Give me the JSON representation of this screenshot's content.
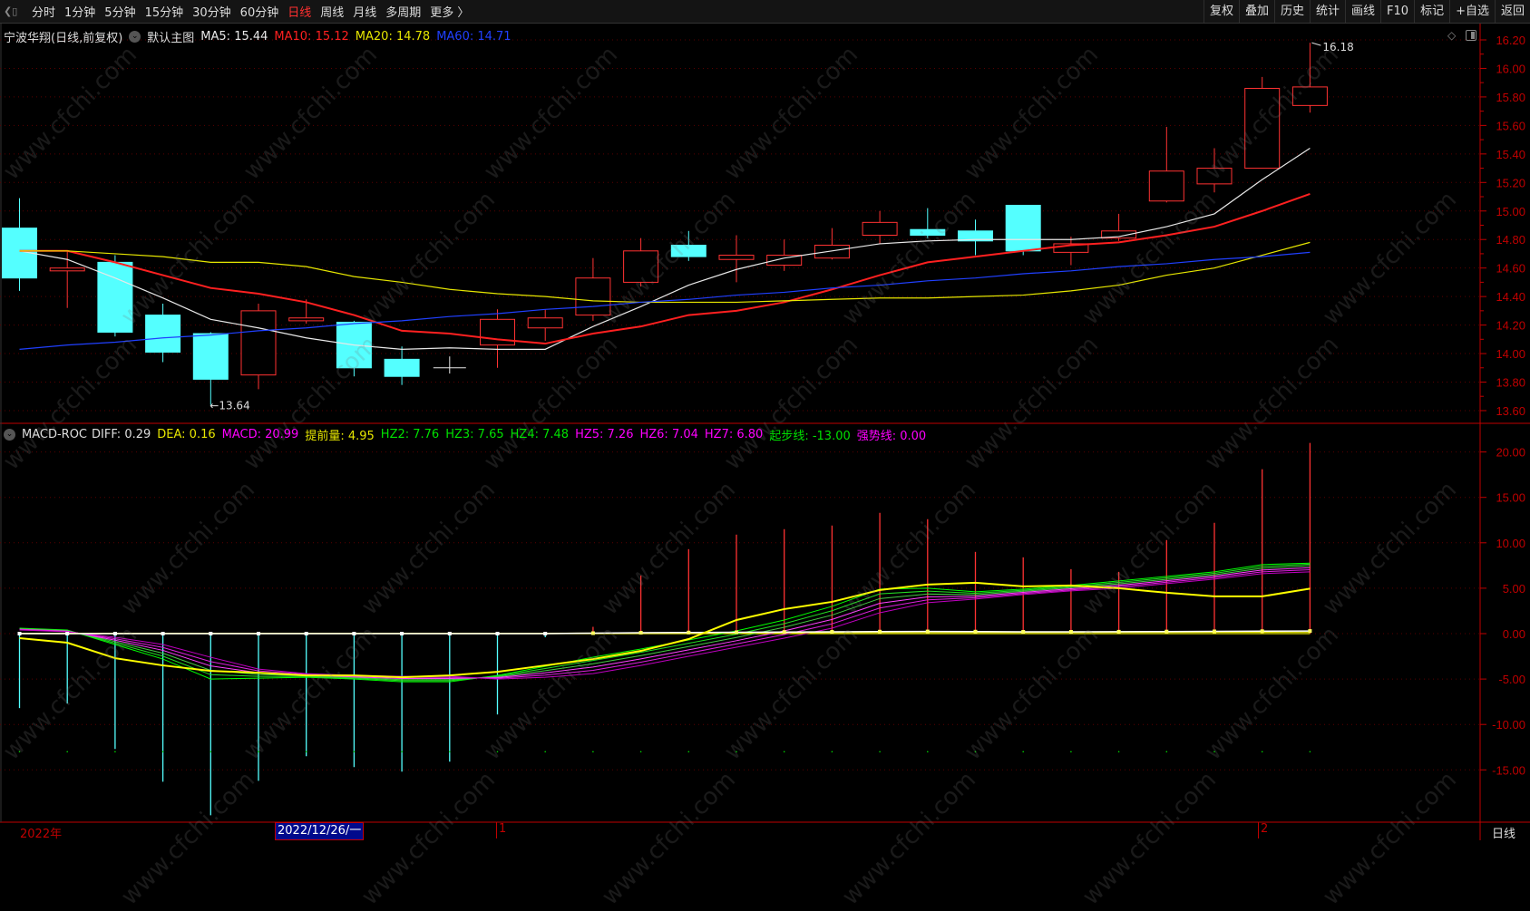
{
  "toolbar": {
    "periods": [
      "分时",
      "1分钟",
      "5分钟",
      "15分钟",
      "30分钟",
      "60分钟",
      "日线",
      "周线",
      "月线",
      "多周期",
      "更多 〉"
    ],
    "active_period": "日线",
    "right_buttons": [
      "复权",
      "叠加",
      "历史",
      "统计",
      "画线",
      "F10",
      "标记",
      "+自选",
      "返回"
    ]
  },
  "price_header": {
    "title": "宁波华翔(日线,前复权)",
    "template": "默认主图",
    "ma5": "MA5: 15.44",
    "ma10": "MA10: 15.12",
    "ma20": "MA20: 14.78",
    "ma60": "MA60: 14.71"
  },
  "indicator_header": {
    "name": "MACD-ROC",
    "diff": "DIFF: 0.29",
    "dea": "DEA: 0.16",
    "macd": "MACD: 20.99",
    "tiqian": "提前量: 4.95",
    "hz2": "HZ2: 7.76",
    "hz3": "HZ3: 7.65",
    "hz4": "HZ4: 7.48",
    "hz5": "HZ5: 7.26",
    "hz6": "HZ6: 7.04",
    "hz7": "HZ7: 6.80",
    "qibu": "起步线: -13.00",
    "qiangshi": "强势线: 0.00"
  },
  "annotations": {
    "high": "16.18",
    "low": "←13.64"
  },
  "x_axis": {
    "year": "2022年",
    "cursor_date": "2022/12/26/一",
    "month1": "1",
    "month2": "2",
    "period": "日线"
  },
  "watermark": "www.cfchi.com",
  "colors": {
    "up": "#ff3232",
    "down": "#54ffff",
    "ma5": "#e8e8e8",
    "ma10": "#ff2020",
    "ma20": "#e6e600",
    "ma60": "#2040ff",
    "axis": "#c00000",
    "hz_green": "#00e000",
    "hz_magenta": "#ff00ff",
    "tiqian": "#ffff00"
  },
  "chart_data": [
    {
      "type": "candlestick",
      "y_ticks": [
        "16.20",
        "16.00",
        "15.80",
        "15.60",
        "15.40",
        "15.20",
        "15.00",
        "14.80",
        "14.60",
        "14.40",
        "14.20",
        "14.00",
        "13.80",
        "13.60"
      ],
      "ylim": [
        13.6,
        16.2
      ],
      "candles": [
        {
          "o": 14.88,
          "h": 15.09,
          "l": 14.44,
          "c": 14.53
        },
        {
          "o": 14.58,
          "h": 14.72,
          "l": 14.32,
          "c": 14.6
        },
        {
          "o": 14.64,
          "h": 14.69,
          "l": 14.12,
          "c": 14.15
        },
        {
          "o": 14.27,
          "h": 14.35,
          "l": 13.94,
          "c": 14.01
        },
        {
          "o": 14.14,
          "h": 14.15,
          "l": 13.64,
          "c": 13.82
        },
        {
          "o": 13.85,
          "h": 14.35,
          "l": 13.75,
          "c": 14.3
        },
        {
          "o": 14.23,
          "h": 14.38,
          "l": 14.21,
          "c": 14.25
        },
        {
          "o": 14.22,
          "h": 14.23,
          "l": 13.84,
          "c": 13.9
        },
        {
          "o": 13.96,
          "h": 14.05,
          "l": 13.78,
          "c": 13.84
        },
        {
          "o": 13.9,
          "h": 13.98,
          "l": 13.86,
          "c": 13.9
        },
        {
          "o": 14.06,
          "h": 14.31,
          "l": 13.9,
          "c": 14.24
        },
        {
          "o": 14.18,
          "h": 14.31,
          "l": 14.09,
          "c": 14.25
        },
        {
          "o": 14.27,
          "h": 14.67,
          "l": 14.23,
          "c": 14.53
        },
        {
          "o": 14.5,
          "h": 14.81,
          "l": 14.47,
          "c": 14.72
        },
        {
          "o": 14.76,
          "h": 14.86,
          "l": 14.65,
          "c": 14.68
        },
        {
          "o": 14.66,
          "h": 14.83,
          "l": 14.5,
          "c": 14.69
        },
        {
          "o": 14.62,
          "h": 14.8,
          "l": 14.58,
          "c": 14.69
        },
        {
          "o": 14.67,
          "h": 14.88,
          "l": 14.66,
          "c": 14.76
        },
        {
          "o": 14.83,
          "h": 15.0,
          "l": 14.77,
          "c": 14.92
        },
        {
          "o": 14.87,
          "h": 15.02,
          "l": 14.81,
          "c": 14.83
        },
        {
          "o": 14.86,
          "h": 14.94,
          "l": 14.69,
          "c": 14.79
        },
        {
          "o": 15.04,
          "h": 15.04,
          "l": 14.69,
          "c": 14.72
        },
        {
          "o": 14.71,
          "h": 14.82,
          "l": 14.62,
          "c": 14.77
        },
        {
          "o": 14.81,
          "h": 14.98,
          "l": 14.79,
          "c": 14.86
        },
        {
          "o": 15.07,
          "h": 15.59,
          "l": 15.06,
          "c": 15.28
        },
        {
          "o": 15.19,
          "h": 15.44,
          "l": 15.13,
          "c": 15.3
        },
        {
          "o": 15.3,
          "h": 15.94,
          "l": 15.3,
          "c": 15.86
        },
        {
          "o": 15.74,
          "h": 16.18,
          "l": 15.69,
          "c": 15.87
        }
      ],
      "series": [
        {
          "name": "MA5",
          "values": [
            14.72,
            14.66,
            14.53,
            14.39,
            14.24,
            14.18,
            14.11,
            14.06,
            14.03,
            14.04,
            14.03,
            14.03,
            14.19,
            14.33,
            14.48,
            14.59,
            14.67,
            14.72,
            14.77,
            14.79,
            14.8,
            14.8,
            14.8,
            14.82,
            14.89,
            14.98,
            15.22,
            15.44
          ]
        },
        {
          "name": "MA10",
          "values": [
            14.72,
            14.72,
            14.64,
            14.55,
            14.46,
            14.42,
            14.36,
            14.27,
            14.16,
            14.14,
            14.1,
            14.07,
            14.14,
            14.19,
            14.27,
            14.3,
            14.36,
            14.45,
            14.55,
            14.64,
            14.68,
            14.72,
            14.76,
            14.78,
            14.83,
            14.89,
            15.0,
            15.12
          ]
        },
        {
          "name": "MA20",
          "values": [
            14.72,
            14.72,
            14.7,
            14.68,
            14.64,
            14.64,
            14.61,
            14.54,
            14.5,
            14.45,
            14.42,
            14.4,
            14.37,
            14.36,
            14.36,
            14.36,
            14.37,
            14.38,
            14.39,
            14.39,
            14.4,
            14.41,
            14.44,
            14.48,
            14.55,
            14.6,
            14.69,
            14.78
          ]
        },
        {
          "name": "MA60",
          "values": [
            14.03,
            14.06,
            14.08,
            14.11,
            14.13,
            14.16,
            14.18,
            14.21,
            14.23,
            14.26,
            14.28,
            14.31,
            14.33,
            14.36,
            14.38,
            14.41,
            14.43,
            14.46,
            14.48,
            14.51,
            14.53,
            14.56,
            14.58,
            14.61,
            14.63,
            14.66,
            14.68,
            14.71
          ]
        }
      ]
    },
    {
      "type": "bar+line",
      "y_ticks": [
        "20.00",
        "15.00",
        "10.00",
        "5.00",
        "0.00",
        "-5.00",
        "-10.00",
        "-15.00"
      ],
      "ylim": [
        -20,
        21
      ],
      "macd": [
        -8.2,
        -7.7,
        -12.7,
        -16.3,
        -20.0,
        -16.2,
        -13.5,
        -14.7,
        -15.2,
        -14.1,
        -8.9,
        -0.4,
        0.75,
        6.4,
        9.3,
        10.9,
        11.5,
        11.9,
        13.3,
        12.6,
        9.0,
        8.4,
        7.1,
        6.8,
        10.3,
        12.2,
        18.1,
        20.99
      ],
      "series": [
        {
          "name": "DIFF",
          "values": [
            0.0,
            0.0,
            0.0,
            0.0,
            0.0,
            0.0,
            0.0,
            0.0,
            0.0,
            0.0,
            0.0,
            0.0,
            0.05,
            0.1,
            0.12,
            0.15,
            0.18,
            0.2,
            0.22,
            0.24,
            0.22,
            0.2,
            0.2,
            0.21,
            0.23,
            0.25,
            0.27,
            0.29
          ]
        },
        {
          "name": "DEA",
          "values": [
            0.05,
            0.05,
            0.05,
            0.05,
            0.05,
            0.05,
            0.05,
            0.05,
            0.05,
            0.05,
            0.05,
            0.05,
            0.06,
            0.07,
            0.08,
            0.09,
            0.1,
            0.11,
            0.12,
            0.13,
            0.13,
            0.13,
            0.13,
            0.14,
            0.14,
            0.15,
            0.15,
            0.16
          ]
        },
        {
          "name": "提前量",
          "values": [
            -0.5,
            -1.0,
            -2.7,
            -3.5,
            -4.1,
            -4.3,
            -4.6,
            -4.6,
            -4.8,
            -4.6,
            -4.2,
            -3.5,
            -2.8,
            -1.9,
            -0.6,
            1.5,
            2.7,
            3.5,
            4.8,
            5.4,
            5.6,
            5.2,
            5.3,
            5.0,
            4.5,
            4.1,
            4.1,
            4.95
          ]
        },
        {
          "name": "HZ2",
          "values": [
            0.6,
            0.4,
            -1.2,
            -2.8,
            -5.0,
            -4.9,
            -4.8,
            -5.0,
            -5.3,
            -5.3,
            -4.6,
            -3.6,
            -2.6,
            -1.7,
            -0.7,
            0.3,
            1.5,
            3.0,
            4.9,
            5.0,
            4.6,
            4.9,
            5.3,
            5.8,
            6.3,
            6.8,
            7.6,
            7.76
          ]
        },
        {
          "name": "HZ3",
          "values": [
            0.56,
            0.36,
            -1.04,
            -2.48,
            -4.52,
            -4.7,
            -4.72,
            -4.92,
            -5.18,
            -5.18,
            -4.68,
            -3.84,
            -2.96,
            -2.06,
            -1.06,
            -0.06,
            1.1,
            2.52,
            4.38,
            4.68,
            4.44,
            4.78,
            5.18,
            5.64,
            6.14,
            6.64,
            7.4,
            7.65
          ]
        },
        {
          "name": "HZ4",
          "values": [
            0.52,
            0.32,
            -0.88,
            -2.16,
            -4.04,
            -4.5,
            -4.64,
            -4.84,
            -5.06,
            -5.06,
            -4.76,
            -4.08,
            -3.32,
            -2.42,
            -1.42,
            -0.42,
            0.7,
            2.04,
            3.86,
            4.36,
            4.28,
            4.66,
            5.06,
            5.48,
            5.98,
            6.48,
            7.2,
            7.48
          ]
        },
        {
          "name": "HZ5",
          "values": [
            0.48,
            0.28,
            -0.72,
            -1.84,
            -3.56,
            -4.3,
            -4.56,
            -4.76,
            -4.94,
            -4.94,
            -4.84,
            -4.32,
            -3.68,
            -2.78,
            -1.78,
            -0.78,
            0.3,
            1.56,
            3.34,
            4.04,
            4.12,
            4.54,
            4.94,
            5.32,
            5.82,
            6.32,
            7.0,
            7.26
          ]
        },
        {
          "name": "HZ6",
          "values": [
            0.44,
            0.24,
            -0.56,
            -1.52,
            -3.08,
            -4.1,
            -4.48,
            -4.68,
            -4.82,
            -4.82,
            -4.92,
            -4.56,
            -4.04,
            -3.14,
            -2.14,
            -1.14,
            -0.1,
            1.08,
            2.82,
            3.72,
            3.96,
            4.42,
            4.82,
            5.16,
            5.66,
            6.16,
            6.8,
            7.04
          ]
        },
        {
          "name": "HZ7",
          "values": [
            0.4,
            0.2,
            -0.4,
            -1.2,
            -2.6,
            -3.9,
            -4.4,
            -4.6,
            -4.7,
            -4.7,
            -5.0,
            -4.8,
            -4.4,
            -3.5,
            -2.5,
            -1.5,
            -0.5,
            0.6,
            2.3,
            3.4,
            3.8,
            4.3,
            4.7,
            5.0,
            5.5,
            6.0,
            6.6,
            6.8
          ]
        },
        {
          "name": "起步线",
          "value": -13.0
        },
        {
          "name": "强势线",
          "value": 0.0
        }
      ]
    }
  ]
}
